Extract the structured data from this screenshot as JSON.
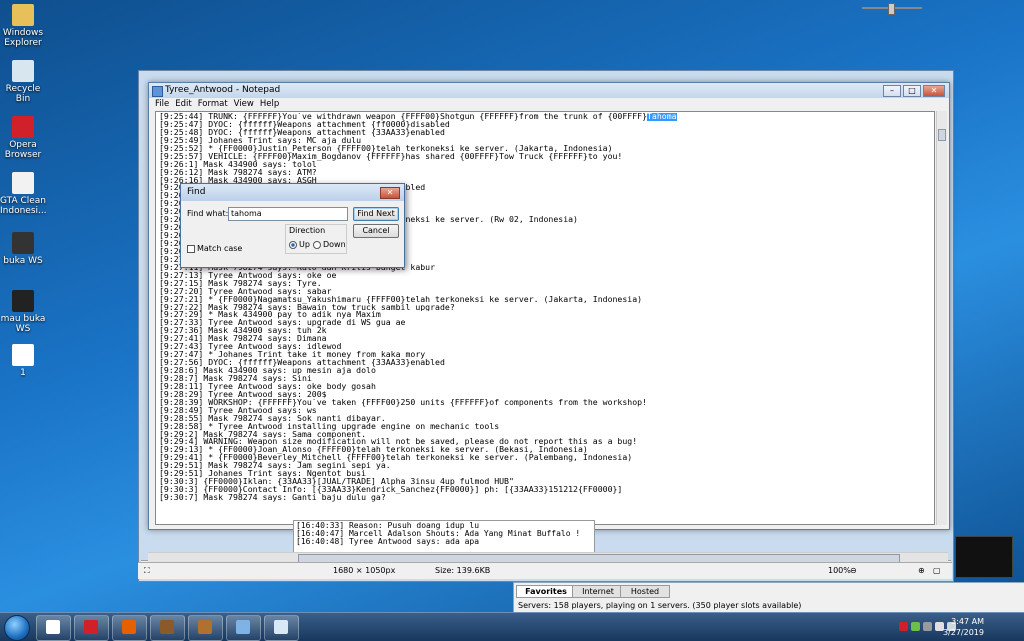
{
  "desktop_icons": [
    {
      "label": "Windows Explorer",
      "icon": "folder-icon",
      "color": "#e7c05a"
    },
    {
      "label": "Recycle Bin",
      "icon": "recycle-bin-icon",
      "color": "#d8e6f0"
    },
    {
      "label": "Opera Browser",
      "icon": "opera-icon",
      "color": "#d0202a"
    },
    {
      "label": "GTA Clean Indonesi...",
      "icon": "document-icon",
      "color": "#f2f2f2"
    },
    {
      "label": "buka WS",
      "icon": "shortcut-icon",
      "color": "#333333"
    },
    {
      "label": "mau buka WS",
      "icon": "shortcut-icon",
      "color": "#222222"
    },
    {
      "label": "1",
      "icon": "text-file-icon",
      "color": "#ffffff"
    }
  ],
  "notepad": {
    "title": "Tyree_Antwood - Notepad",
    "menu": [
      "File",
      "Edit",
      "Format",
      "View",
      "Help"
    ],
    "lines": [
      "[9:25:44] TRUNK: {FFFFFF}You`ve withdrawn weapon {FFFF00}Shotgun {FFFFFF}from the trunk of {00FFFF}",
      "[9:25:47] DYOC: {ffffff}Weapons attachment {ff0000}disabled",
      "[9:25:48] DYOC: {ffffff}Weapons attachment {33AA33}enabled",
      "[9:25:49] Johanes Trint says: MC aja dulu",
      "[9:25:52] * {FF0000}Justin_Peterson {FFFF00}telah terkoneksi ke server. (Jakarta, Indonesia)",
      "[9:25:57] VEHICLE: {FFFF00}Maxim_Bogdanov {FFFFFF}has shared {00FFFF}Tow Truck {FFFFFF}to you!",
      "[9:26:1] Mask 434900 says: tolol",
      "[9:26:12] Mask 798274 says: ATM?",
      "[9:26:16] Mask 434900 says: ASGH",
      "[9:26                                         disabled",
      "[9:26",
      "[9:26",
      "[9:26",
      "[9:26                                         erkoneksi ke server. (Rw 02, Indonesia)",
      "[9:26",
      "[9:26",
      "[9:26",
      "[9:26",
      "[9:27",
      "[9:27:11] Mask 798274 says: Kalo dah kritis banget kabur",
      "[9:27:13] Tyree Antwood says: oke oe",
      "[9:27:15] Mask 798274 says: Tyre.",
      "[9:27:20] Tyree Antwood says: sabar",
      "[9:27:21] * {FF0000}Nagamatsu_Yakushimaru {FFFF00}telah terkoneksi ke server. (Jakarta, Indonesia)",
      "[9:27:22] Mask 798274 says: Bawain tow truck sambil upgrade?",
      "[9:27:29] * Mask 434900 pay to adik nya Maxim",
      "[9:27:33] Tyree Antwood says: upgrade di WS gua ae",
      "[9:27:36] Mask 434900 says: tuh 2k",
      "[9:27:41] Mask 798274 says: Dimana",
      "[9:27:43] Tyree Antwood says: idlewod",
      "[9:27:47] * Johanes Trint take it money from kaka mory",
      "[9:27:56] DYOC: {ffffff}Weapons attachment {33AA33}enabled",
      "[9:28:6] Mask 434900 says: up mesin aja dolo",
      "[9:28:7] Mask 798274 says: Sini",
      "[9:28:11] Tyree Antwood says: oke body gosah",
      "[9:28:29] Tyree Antwood says: 200$",
      "[9:28:39] WORKSHOP: {FFFFFF}You`ve taken {FFFF00}250 units {FFFFFF}of components from the workshop!",
      "[9:28:49] Tyree Antwood says: ws",
      "[9:28:55] Mask 798274 says: Sok nanti dibayar.",
      "[9:28:58] * Tyree Antwood installing upgrade engine on mechanic tools",
      "[9:29:2] Mask 798274 says: Sama component.",
      "[9:29:4] WARNING: Weapon size modification will not be saved, please do not report this as a bug!",
      "[9:29:13] * {FF0000}Joan_Alonso {FFFF00}telah terkoneksi ke server. (Bekasi, Indonesia)",
      "[9:29:41] * {FF0000}Beverley_Mitchell {FFFF00}telah terkoneksi ke server. (Palembang, Indonesia)",
      "[9:29:51] Mask 798274 says: Jam segini sepi ya.",
      "[9:29:51] Johanes Trint says: Ngentot busi",
      "[9:30:3] {FF0000}Iklan: {33AA33}[JUAL/TRADE] Alpha 3insu 4up fulmod HUB\"",
      "[9:30:3] {FF0000}Contact Info: [{33AA33}Kendrick_Sanchez{FF0000}] ph: [{33AA33}151212{FF0000}]",
      "[9:30:7] Mask 798274 says: Ganti baju dulu ga?"
    ],
    "highlight": "Tahoma",
    "status": {
      "dims": "1680 × 1050px",
      "size": "Size: 139.6KB",
      "zoom": "100%"
    }
  },
  "find": {
    "title": "Find",
    "label": "Find what:",
    "value": "tahoma",
    "find_next": "Find Next",
    "cancel": "Cancel",
    "direction": "Direction",
    "up": "Up",
    "down": "Down",
    "match_case": "Match case"
  },
  "chat_lines": [
    "[16:40:33] Reason: Pusuh doang idup lu",
    "[16:40:47] Marcell Adalson Shouts: Ada Yang Minat Buffalo !",
    "[16:40:48] Tyree Antwood says: ada apa"
  ],
  "servers": {
    "tabs": [
      "Favorites",
      "Internet",
      "Hosted"
    ],
    "info": "Servers: 158 players, playing on 1 servers. (350 player slots available)"
  },
  "taskbar": {
    "buttons": [
      {
        "icon": "file-icon",
        "color": "#ffffff"
      },
      {
        "icon": "opera-icon",
        "color": "#d0202a"
      },
      {
        "icon": "firefox-icon",
        "color": "#e66000"
      },
      {
        "icon": "game-icon",
        "color": "#8a5a2a"
      },
      {
        "icon": "gta-icon",
        "color": "#b07030"
      },
      {
        "icon": "notepad-icon",
        "color": "#7fb3e6"
      },
      {
        "icon": "paint-icon",
        "color": "#d9e8f7"
      }
    ],
    "time": "3:47 AM",
    "date": "3/27/2019"
  }
}
